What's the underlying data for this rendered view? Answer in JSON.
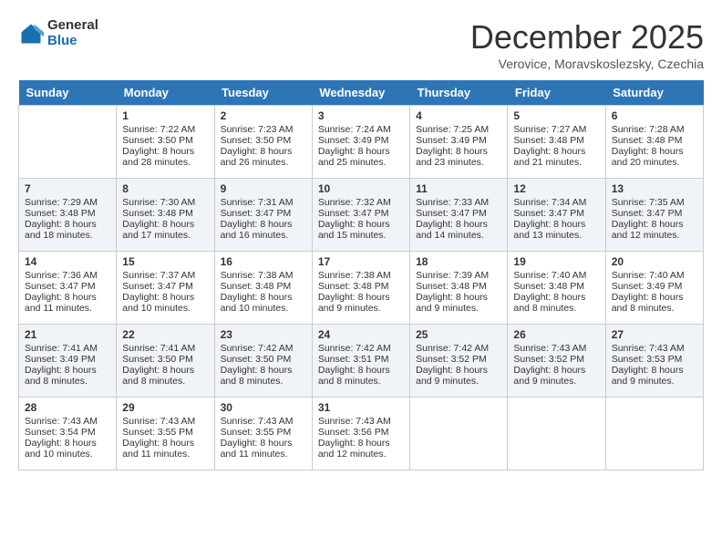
{
  "logo": {
    "general": "General",
    "blue": "Blue"
  },
  "title": "December 2025",
  "location": "Verovice, Moravskoslezsky, Czechia",
  "days_of_week": [
    "Sunday",
    "Monday",
    "Tuesday",
    "Wednesday",
    "Thursday",
    "Friday",
    "Saturday"
  ],
  "weeks": [
    [
      {
        "day": "",
        "info": ""
      },
      {
        "day": "1",
        "info": "Sunrise: 7:22 AM\nSunset: 3:50 PM\nDaylight: 8 hours\nand 28 minutes."
      },
      {
        "day": "2",
        "info": "Sunrise: 7:23 AM\nSunset: 3:50 PM\nDaylight: 8 hours\nand 26 minutes."
      },
      {
        "day": "3",
        "info": "Sunrise: 7:24 AM\nSunset: 3:49 PM\nDaylight: 8 hours\nand 25 minutes."
      },
      {
        "day": "4",
        "info": "Sunrise: 7:25 AM\nSunset: 3:49 PM\nDaylight: 8 hours\nand 23 minutes."
      },
      {
        "day": "5",
        "info": "Sunrise: 7:27 AM\nSunset: 3:48 PM\nDaylight: 8 hours\nand 21 minutes."
      },
      {
        "day": "6",
        "info": "Sunrise: 7:28 AM\nSunset: 3:48 PM\nDaylight: 8 hours\nand 20 minutes."
      }
    ],
    [
      {
        "day": "7",
        "info": "Sunrise: 7:29 AM\nSunset: 3:48 PM\nDaylight: 8 hours\nand 18 minutes."
      },
      {
        "day": "8",
        "info": "Sunrise: 7:30 AM\nSunset: 3:48 PM\nDaylight: 8 hours\nand 17 minutes."
      },
      {
        "day": "9",
        "info": "Sunrise: 7:31 AM\nSunset: 3:47 PM\nDaylight: 8 hours\nand 16 minutes."
      },
      {
        "day": "10",
        "info": "Sunrise: 7:32 AM\nSunset: 3:47 PM\nDaylight: 8 hours\nand 15 minutes."
      },
      {
        "day": "11",
        "info": "Sunrise: 7:33 AM\nSunset: 3:47 PM\nDaylight: 8 hours\nand 14 minutes."
      },
      {
        "day": "12",
        "info": "Sunrise: 7:34 AM\nSunset: 3:47 PM\nDaylight: 8 hours\nand 13 minutes."
      },
      {
        "day": "13",
        "info": "Sunrise: 7:35 AM\nSunset: 3:47 PM\nDaylight: 8 hours\nand 12 minutes."
      }
    ],
    [
      {
        "day": "14",
        "info": "Sunrise: 7:36 AM\nSunset: 3:47 PM\nDaylight: 8 hours\nand 11 minutes."
      },
      {
        "day": "15",
        "info": "Sunrise: 7:37 AM\nSunset: 3:47 PM\nDaylight: 8 hours\nand 10 minutes."
      },
      {
        "day": "16",
        "info": "Sunrise: 7:38 AM\nSunset: 3:48 PM\nDaylight: 8 hours\nand 10 minutes."
      },
      {
        "day": "17",
        "info": "Sunrise: 7:38 AM\nSunset: 3:48 PM\nDaylight: 8 hours\nand 9 minutes."
      },
      {
        "day": "18",
        "info": "Sunrise: 7:39 AM\nSunset: 3:48 PM\nDaylight: 8 hours\nand 9 minutes."
      },
      {
        "day": "19",
        "info": "Sunrise: 7:40 AM\nSunset: 3:48 PM\nDaylight: 8 hours\nand 8 minutes."
      },
      {
        "day": "20",
        "info": "Sunrise: 7:40 AM\nSunset: 3:49 PM\nDaylight: 8 hours\nand 8 minutes."
      }
    ],
    [
      {
        "day": "21",
        "info": "Sunrise: 7:41 AM\nSunset: 3:49 PM\nDaylight: 8 hours\nand 8 minutes."
      },
      {
        "day": "22",
        "info": "Sunrise: 7:41 AM\nSunset: 3:50 PM\nDaylight: 8 hours\nand 8 minutes."
      },
      {
        "day": "23",
        "info": "Sunrise: 7:42 AM\nSunset: 3:50 PM\nDaylight: 8 hours\nand 8 minutes."
      },
      {
        "day": "24",
        "info": "Sunrise: 7:42 AM\nSunset: 3:51 PM\nDaylight: 8 hours\nand 8 minutes."
      },
      {
        "day": "25",
        "info": "Sunrise: 7:42 AM\nSunset: 3:52 PM\nDaylight: 8 hours\nand 9 minutes."
      },
      {
        "day": "26",
        "info": "Sunrise: 7:43 AM\nSunset: 3:52 PM\nDaylight: 8 hours\nand 9 minutes."
      },
      {
        "day": "27",
        "info": "Sunrise: 7:43 AM\nSunset: 3:53 PM\nDaylight: 8 hours\nand 9 minutes."
      }
    ],
    [
      {
        "day": "28",
        "info": "Sunrise: 7:43 AM\nSunset: 3:54 PM\nDaylight: 8 hours\nand 10 minutes."
      },
      {
        "day": "29",
        "info": "Sunrise: 7:43 AM\nSunset: 3:55 PM\nDaylight: 8 hours\nand 11 minutes."
      },
      {
        "day": "30",
        "info": "Sunrise: 7:43 AM\nSunset: 3:55 PM\nDaylight: 8 hours\nand 11 minutes."
      },
      {
        "day": "31",
        "info": "Sunrise: 7:43 AM\nSunset: 3:56 PM\nDaylight: 8 hours\nand 12 minutes."
      },
      {
        "day": "",
        "info": ""
      },
      {
        "day": "",
        "info": ""
      },
      {
        "day": "",
        "info": ""
      }
    ]
  ]
}
